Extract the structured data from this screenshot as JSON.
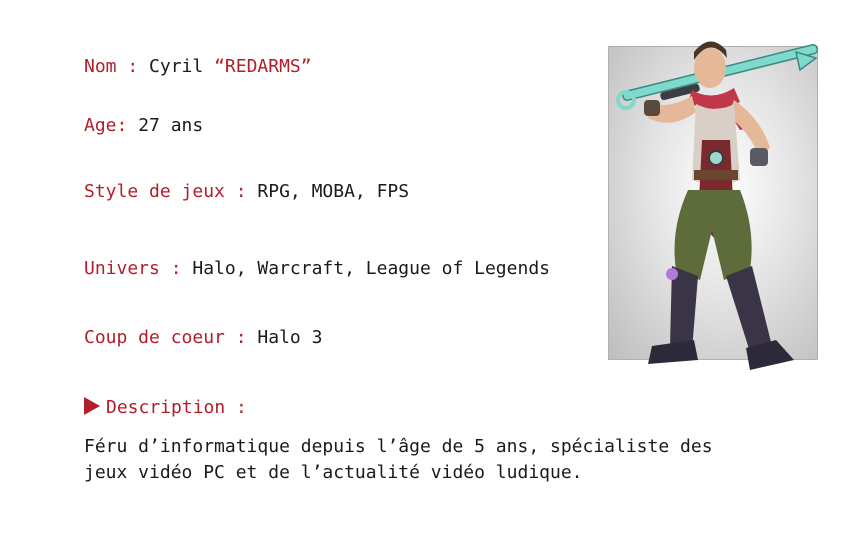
{
  "profile": {
    "nom": {
      "label": "Nom : ",
      "value": "Cyril ",
      "nickname": "“REDARMS”"
    },
    "age": {
      "label": "Age: ",
      "value": "27 ans"
    },
    "style": {
      "label": "Style de jeux : ",
      "value": "RPG, MOBA, FPS"
    },
    "univers": {
      "label": "Univers : ",
      "value": "Halo, Warcraft, League of Legends"
    },
    "coup": {
      "label": "Coup de coeur : ",
      "value": "Halo 3"
    },
    "description": {
      "label": "Description :",
      "text": "Féru d’informatique depuis l’âge de 5 ans, spécialiste des jeux vidéo PC et de l’actualité vidéo ludique."
    }
  },
  "colors": {
    "label": "#b21e2a",
    "text": "#1a1a1a",
    "weapon": "#7fd9cc",
    "scarf": "#c0374a",
    "pants": "#5e6b3a",
    "tunic": "#7a2a2c",
    "boots": "#2c2a3a"
  },
  "icons": {
    "bullet": "play-triangle-icon",
    "portrait": "character-illustration"
  }
}
